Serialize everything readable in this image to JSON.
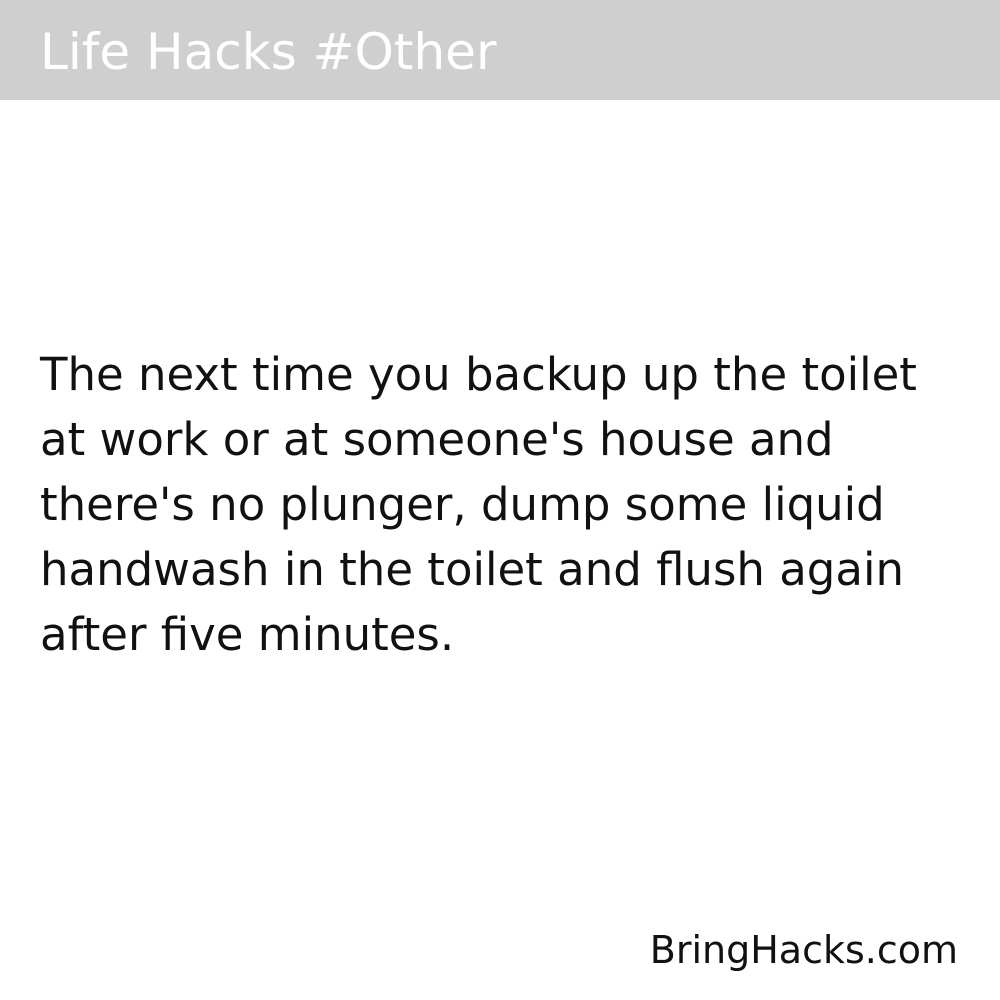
{
  "header": {
    "title": "Life Hacks #Other",
    "background_color": "#cfcfcf",
    "text_color": "#ffffff"
  },
  "hack": {
    "text": "The next time you backup up the toilet at work or at someone's house and there's no plunger, dump some liquid handwash in the toilet and flush again after five minutes."
  },
  "footer": {
    "site": "BringHacks.com"
  }
}
